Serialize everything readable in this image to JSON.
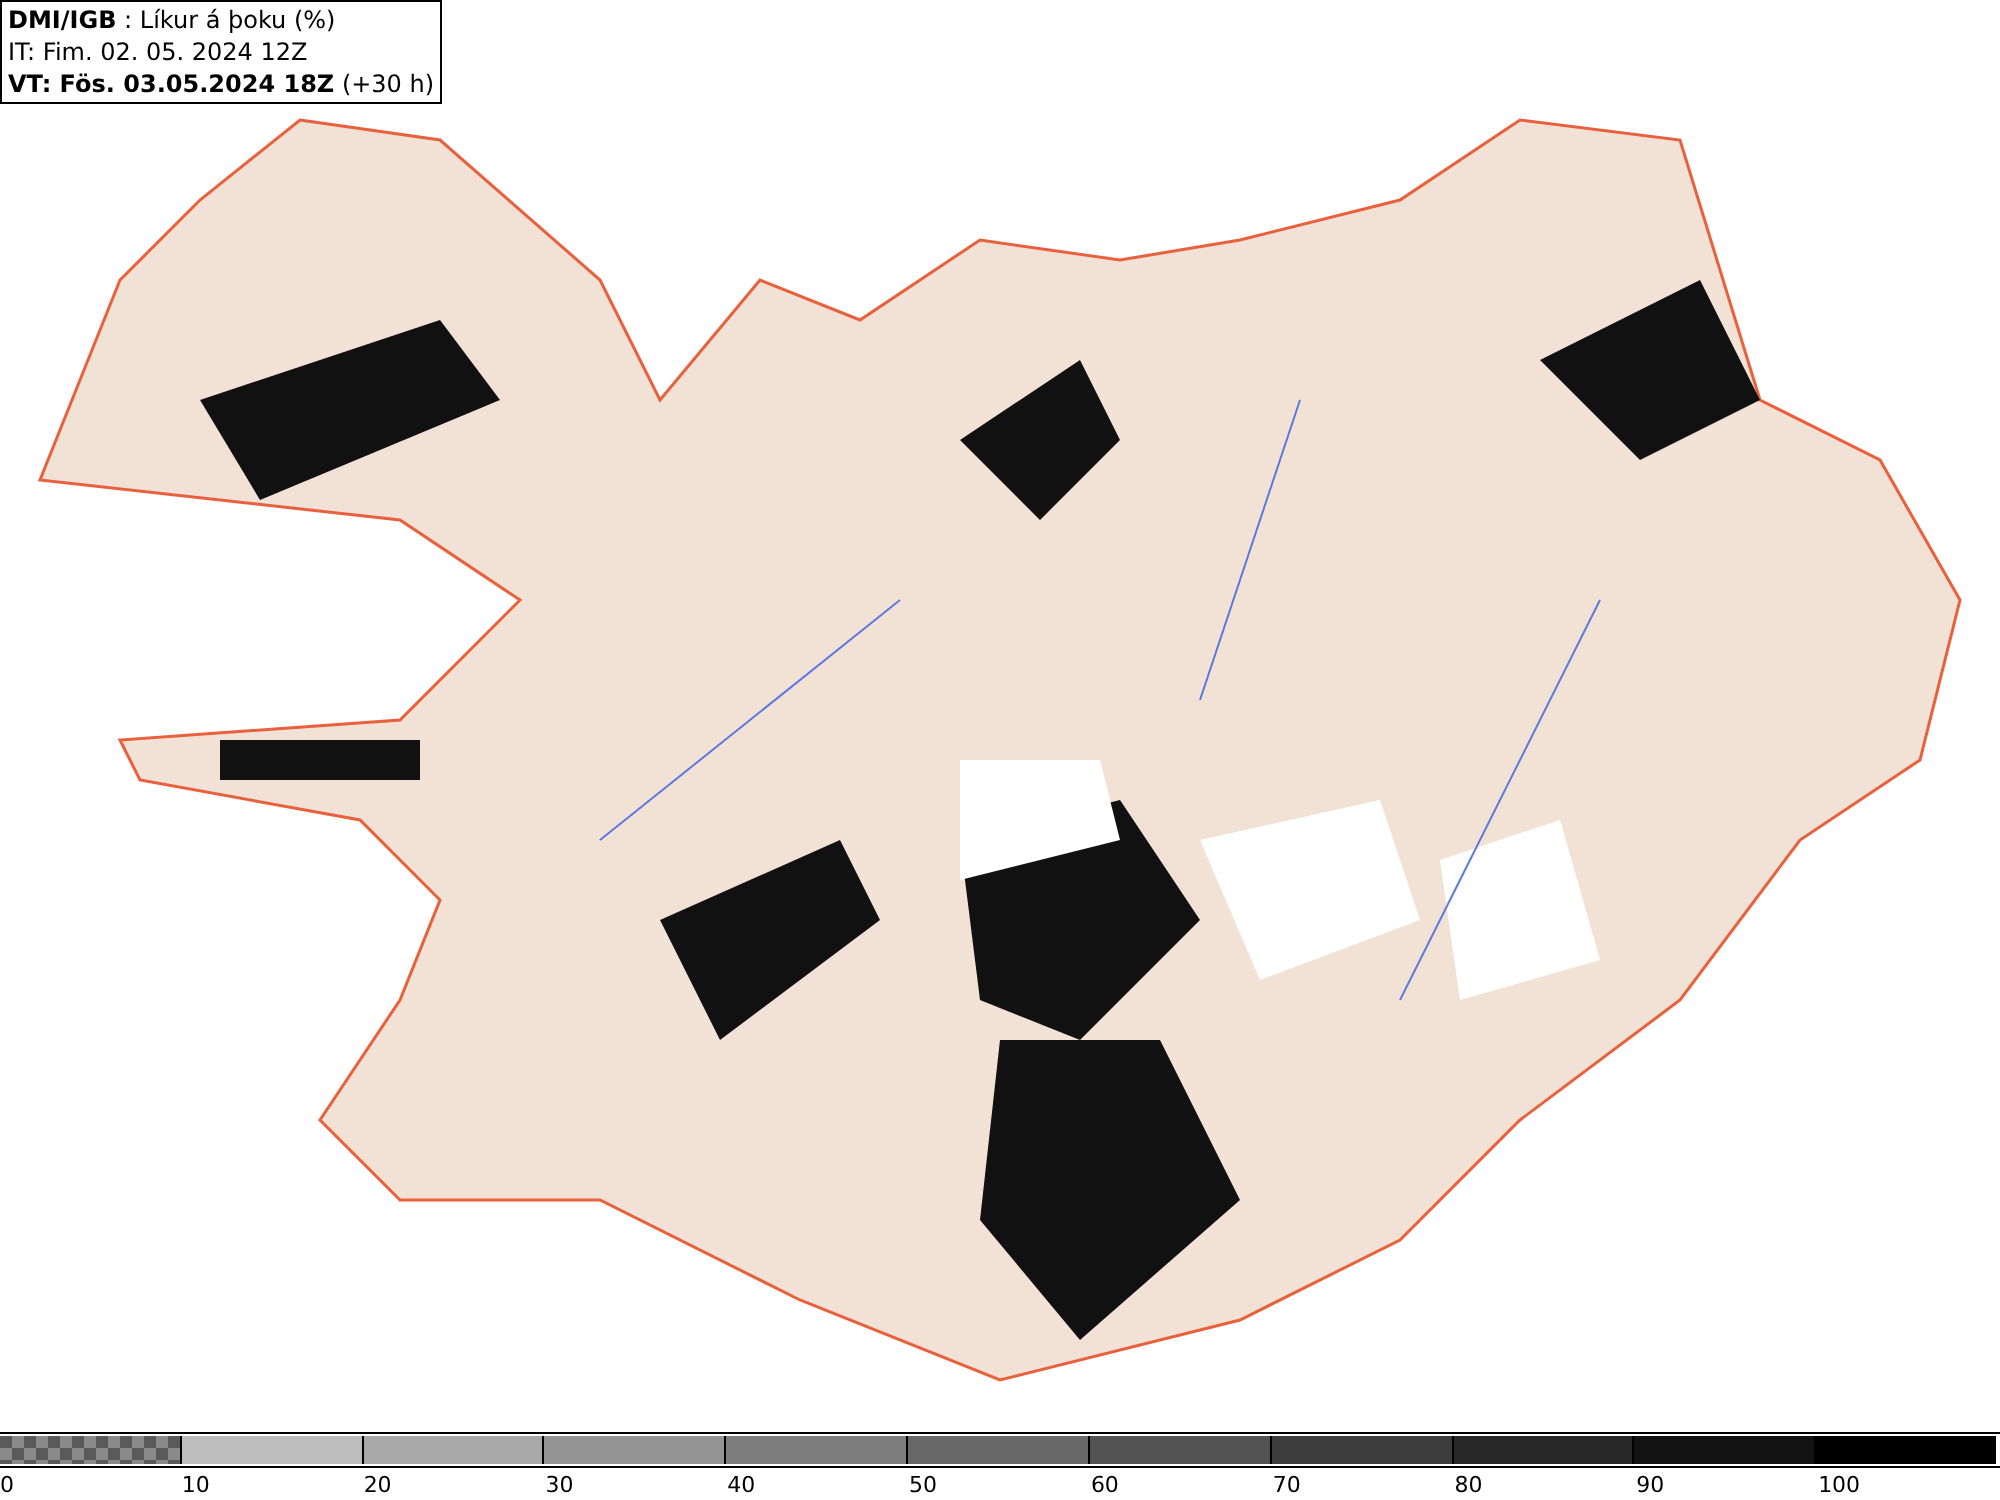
{
  "header": {
    "source": "DMI/IGB",
    "title": " : Líkur á þoku (%)",
    "issue_time": "IT: Fim. 02. 05. 2024 12Z",
    "valid_time": "VT: Fös. 03.05.2024 18Z",
    "lead": " (+30 h)"
  },
  "legend": [
    {
      "label": "0",
      "kind": "checker",
      "color": "#5a5a5a"
    },
    {
      "label": "10",
      "kind": "solid",
      "color": "#bdbdbd"
    },
    {
      "label": "20",
      "kind": "solid",
      "color": "#a8a8a8"
    },
    {
      "label": "30",
      "kind": "solid",
      "color": "#939393"
    },
    {
      "label": "40",
      "kind": "solid",
      "color": "#7d7d7d"
    },
    {
      "label": "50",
      "kind": "solid",
      "color": "#686868"
    },
    {
      "label": "60",
      "kind": "solid",
      "color": "#535353"
    },
    {
      "label": "70",
      "kind": "solid",
      "color": "#3d3d3d"
    },
    {
      "label": "80",
      "kind": "solid",
      "color": "#282828"
    },
    {
      "label": "90",
      "kind": "solid",
      "color": "#131313"
    },
    {
      "label": "100",
      "kind": "solid",
      "color": "#000000"
    }
  ]
}
